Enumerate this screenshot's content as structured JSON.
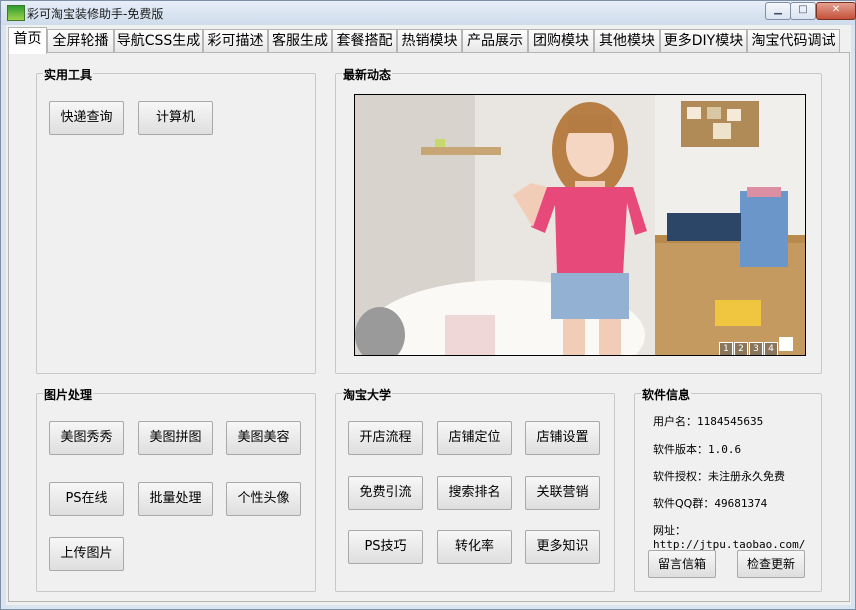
{
  "window": {
    "title": "彩可淘宝装修助手-免费版"
  },
  "tabs": [
    {
      "label": "首页",
      "active": true
    },
    {
      "label": "全屏轮播"
    },
    {
      "label": "导航CSS生成"
    },
    {
      "label": "彩可描述"
    },
    {
      "label": "客服生成"
    },
    {
      "label": "套餐搭配"
    },
    {
      "label": "热销模块"
    },
    {
      "label": "产品展示"
    },
    {
      "label": "团购模块"
    },
    {
      "label": "其他模块"
    },
    {
      "label": "更多DIY模块"
    },
    {
      "label": "淘宝代码调试"
    }
  ],
  "tools": {
    "title": "实用工具",
    "buttons": [
      "快递查询",
      "计算机"
    ]
  },
  "news": {
    "title": "最新动态",
    "pager": [
      "1",
      "2",
      "3",
      "4",
      ""
    ]
  },
  "image_processing": {
    "title": "图片处理",
    "buttons": [
      "美图秀秀",
      "美图拼图",
      "美图美容",
      "PS在线",
      "批量处理",
      "个性头像",
      "上传图片"
    ]
  },
  "taobao_university": {
    "title": "淘宝大学",
    "buttons": [
      "开店流程",
      "店铺定位",
      "店铺设置",
      "免费引流",
      "搜索排名",
      "关联营销",
      "PS技巧",
      "转化率",
      "更多知识"
    ]
  },
  "software_info": {
    "title": "软件信息",
    "username_label": "用户名：",
    "username": "1184545635",
    "version_label": "软件版本：",
    "version": "1.0.6",
    "license_label": "软件授权：",
    "license": "未注册永久免费",
    "qq_label": "软件QQ群：",
    "qq": "49681374",
    "url_label": "网址：",
    "url": "http://jtpu.taobao.com/",
    "buttons": [
      "留言信箱",
      "检查更新"
    ]
  },
  "colors": {
    "tab_border": "#b5b5b5",
    "panel_bg": "#f0f0f0",
    "title_bar": "#d9e4f1",
    "close_button": "#c4513a"
  }
}
